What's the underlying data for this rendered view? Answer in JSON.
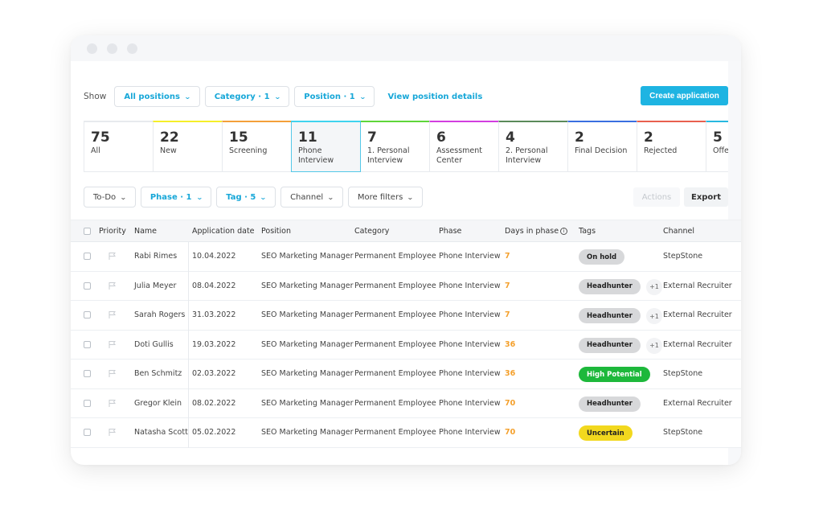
{
  "window": {
    "controls": [
      "close",
      "minimize",
      "maximize"
    ]
  },
  "toolbar": {
    "show_label": "Show",
    "filters": [
      {
        "label": "All positions",
        "active": true
      },
      {
        "label": "Category · 1",
        "active": true
      },
      {
        "label": "Position · 1",
        "active": true
      }
    ],
    "view_position_details": "View position details",
    "create_application": "Create application"
  },
  "stages": [
    {
      "count": "75",
      "label": "All",
      "color": "#e7eaee",
      "active": false
    },
    {
      "count": "22",
      "label": "New",
      "color": "#f5ef2a",
      "active": false
    },
    {
      "count": "15",
      "label": "Screening",
      "color": "#f4a03a",
      "active": false
    },
    {
      "count": "11",
      "label": "Phone Interview",
      "color": "#3fd3ee",
      "active": true
    },
    {
      "count": "7",
      "label": "1. Personal Interview",
      "color": "#5ed63a",
      "active": false
    },
    {
      "count": "6",
      "label": "Assessment Center",
      "color": "#d23ee0",
      "active": false
    },
    {
      "count": "4",
      "label": "2. Personal Interview",
      "color": "#5b8a5a",
      "active": false
    },
    {
      "count": "2",
      "label": "Final Decision",
      "color": "#3a6fe0",
      "active": false
    },
    {
      "count": "2",
      "label": "Rejected",
      "color": "#e8604f",
      "active": false
    },
    {
      "count": "5",
      "label": "Offer",
      "color": "#28b8e0",
      "active": false
    }
  ],
  "filters2": [
    {
      "label": "To-Do",
      "active": false
    },
    {
      "label": "Phase · 1",
      "active": true
    },
    {
      "label": "Tag · 5",
      "active": true
    },
    {
      "label": "Channel",
      "active": false
    },
    {
      "label": "More filters",
      "active": false
    }
  ],
  "actions_label": "Actions",
  "export_label": "Export",
  "table": {
    "headers": {
      "priority": "Priority",
      "name": "Name",
      "date": "Application date",
      "position": "Position",
      "category": "Category",
      "phase": "Phase",
      "days": "Days in phase",
      "tags": "Tags",
      "channel": "Channel"
    },
    "rows": [
      {
        "name": "Rabi Rimes",
        "date": "10.04.2022",
        "position": "SEO Marketing Manager",
        "category": "Permanent Employee",
        "phase": "Phone Interview",
        "days": "7",
        "tag": "On hold",
        "tag_style": "gray",
        "extra": "",
        "channel": "StepStone"
      },
      {
        "name": "Julia Meyer",
        "date": "08.04.2022",
        "position": "SEO Marketing Manager",
        "category": "Permanent Employee",
        "phase": "Phone Interview",
        "days": "7",
        "tag": "Headhunter",
        "tag_style": "gray",
        "extra": "+1",
        "channel": "External Recruiter"
      },
      {
        "name": "Sarah Rogers",
        "date": "31.03.2022",
        "position": "SEO Marketing Manager",
        "category": "Permanent Employee",
        "phase": "Phone Interview",
        "days": "7",
        "tag": "Headhunter",
        "tag_style": "gray",
        "extra": "+1",
        "channel": "External Recruiter"
      },
      {
        "name": "Doti Gullis",
        "date": "19.03.2022",
        "position": "SEO Marketing Manager",
        "category": "Permanent Employee",
        "phase": "Phone Interview",
        "days": "36",
        "tag": "Headhunter",
        "tag_style": "gray",
        "extra": "+1",
        "channel": "External Recruiter"
      },
      {
        "name": "Ben Schmitz",
        "date": "02.03.2022",
        "position": "SEO Marketing Manager",
        "category": "Permanent Employee",
        "phase": "Phone Interview",
        "days": "36",
        "tag": "High Potential",
        "tag_style": "green",
        "extra": "",
        "channel": "StepStone"
      },
      {
        "name": "Gregor Klein",
        "date": "08.02.2022",
        "position": "SEO Marketing Manager",
        "category": "Permanent Employee",
        "phase": "Phone Interview",
        "days": "70",
        "tag": "Headhunter",
        "tag_style": "gray",
        "extra": "",
        "channel": "External Recruiter"
      },
      {
        "name": "Natasha Scott",
        "date": "05.02.2022",
        "position": "SEO Marketing Manager",
        "category": "Permanent Employee",
        "phase": "Phone Interview",
        "days": "70",
        "tag": "Uncertain",
        "tag_style": "yellow",
        "extra": "",
        "channel": "StepStone"
      }
    ]
  },
  "colors": {
    "accent": "#1eb4e2",
    "days_highlight": "#f4a02c",
    "tag_gray": "#d7d8da",
    "tag_green": "#1db83b",
    "tag_yellow": "#f2d81e"
  }
}
